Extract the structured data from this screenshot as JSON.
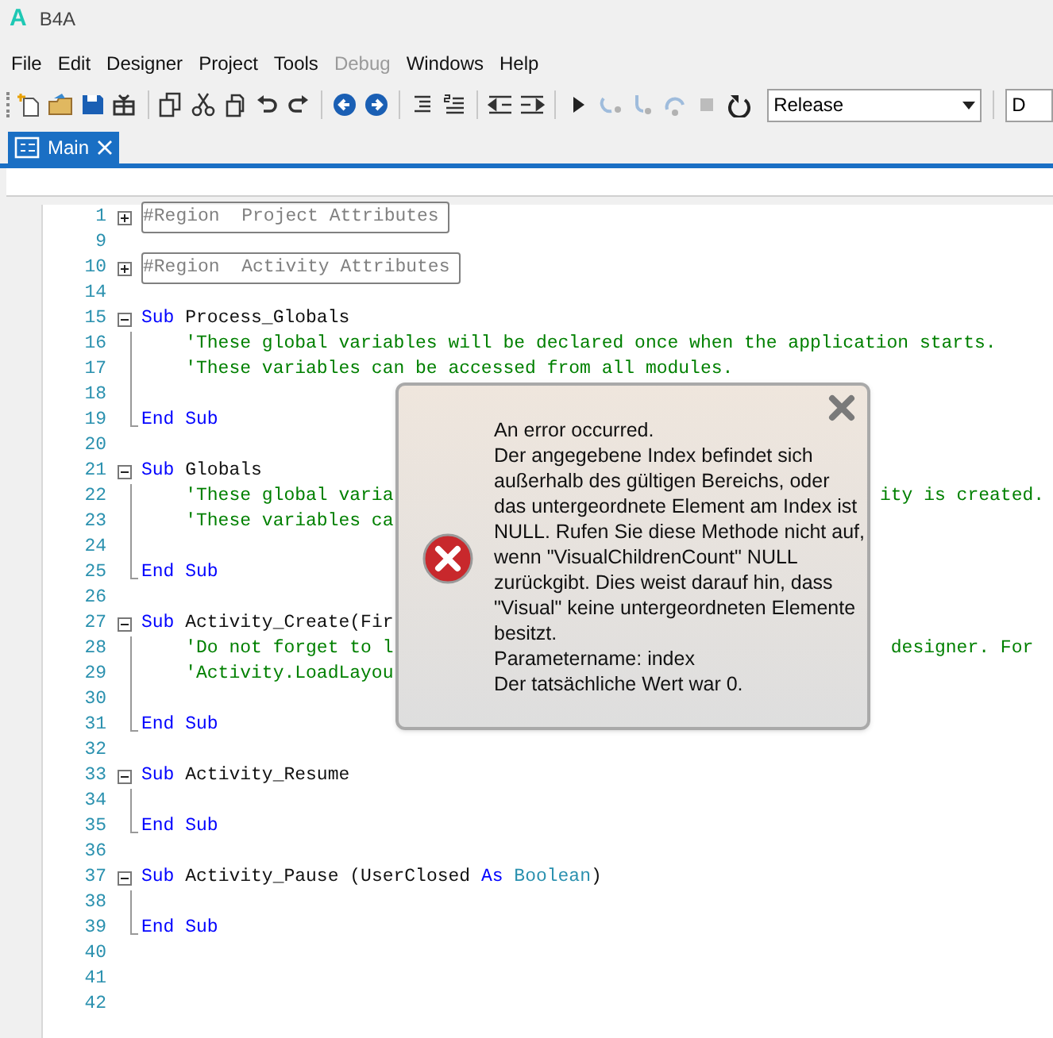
{
  "window": {
    "logo": "A",
    "title": "B4A"
  },
  "menu": [
    {
      "label": "File",
      "disabled": false
    },
    {
      "label": "Edit",
      "disabled": false
    },
    {
      "label": "Designer",
      "disabled": false
    },
    {
      "label": "Project",
      "disabled": false
    },
    {
      "label": "Tools",
      "disabled": false
    },
    {
      "label": "Debug",
      "disabled": true
    },
    {
      "label": "Windows",
      "disabled": false
    },
    {
      "label": "Help",
      "disabled": false
    }
  ],
  "toolbar": [
    {
      "kind": "new",
      "disabled": false
    },
    {
      "kind": "open",
      "disabled": false
    },
    {
      "kind": "save",
      "disabled": false
    },
    {
      "kind": "package",
      "disabled": false
    },
    {
      "kind": "sep"
    },
    {
      "kind": "copy",
      "disabled": false
    },
    {
      "kind": "cut",
      "disabled": false
    },
    {
      "kind": "paste",
      "disabled": false
    },
    {
      "kind": "undo",
      "disabled": false
    },
    {
      "kind": "redo",
      "disabled": false
    },
    {
      "kind": "sep"
    },
    {
      "kind": "back",
      "disabled": false
    },
    {
      "kind": "forward",
      "disabled": false
    },
    {
      "kind": "sep"
    },
    {
      "kind": "lines",
      "disabled": false
    },
    {
      "kind": "numbered",
      "disabled": false
    },
    {
      "kind": "sep"
    },
    {
      "kind": "outdent",
      "disabled": false
    },
    {
      "kind": "indent",
      "disabled": false
    },
    {
      "kind": "sep"
    },
    {
      "kind": "run",
      "disabled": false
    },
    {
      "kind": "step-in",
      "disabled": true
    },
    {
      "kind": "step-over",
      "disabled": true
    },
    {
      "kind": "step-out",
      "disabled": true
    },
    {
      "kind": "stop",
      "disabled": true
    },
    {
      "kind": "restart",
      "disabled": false
    }
  ],
  "build_config": {
    "value": "Release"
  },
  "second_dropdown": {
    "value": "D"
  },
  "tabs": [
    {
      "label": "Main",
      "selected": true
    }
  ],
  "code_lines": [
    {
      "number": "1",
      "kind": "plus",
      "tokens": [
        {
          "kind": "region",
          "text": "#Region  Project Attributes"
        }
      ]
    },
    {
      "number": "9",
      "kind": "none"
    },
    {
      "number": "10",
      "kind": "plus",
      "tokens": [
        {
          "kind": "region",
          "text": "#Region  Activity Attributes"
        }
      ]
    },
    {
      "number": "14",
      "kind": "none"
    },
    {
      "number": "15",
      "kind": "minus",
      "tokens": [
        {
          "kind": "keyword",
          "text": "Sub"
        },
        {
          "kind": "plain",
          "text": " Process_Globals"
        }
      ]
    },
    {
      "number": "16",
      "kind": "guide",
      "tokens": [
        {
          "kind": "comment",
          "text": "    'These global variables will be declared once when the application starts."
        }
      ]
    },
    {
      "number": "17",
      "kind": "guide",
      "tokens": [
        {
          "kind": "comment",
          "text": "    'These variables can be accessed from all modules."
        }
      ]
    },
    {
      "number": "18",
      "kind": "guide"
    },
    {
      "number": "19",
      "kind": "end",
      "tokens": [
        {
          "kind": "keyword",
          "text": "End Sub"
        }
      ]
    },
    {
      "number": "20",
      "kind": "none"
    },
    {
      "number": "21",
      "kind": "minus",
      "tokens": [
        {
          "kind": "keyword",
          "text": "Sub"
        },
        {
          "kind": "plain",
          "text": " Globals"
        }
      ]
    },
    {
      "number": "22",
      "kind": "guide",
      "tokens": [
        {
          "kind": "comment",
          "text": "    'These global varia"
        }
      ],
      "right_tokens": [
        {
          "kind": "comment",
          "text": "ity is created."
        }
      ]
    },
    {
      "number": "23",
      "kind": "guide",
      "tokens": [
        {
          "kind": "comment",
          "text": "    'These variables ca"
        }
      ]
    },
    {
      "number": "24",
      "kind": "guide"
    },
    {
      "number": "25",
      "kind": "end",
      "tokens": [
        {
          "kind": "keyword",
          "text": "End Sub"
        }
      ]
    },
    {
      "number": "26",
      "kind": "none"
    },
    {
      "number": "27",
      "kind": "minus",
      "tokens": [
        {
          "kind": "keyword",
          "text": "Sub"
        },
        {
          "kind": "plain",
          "text": " Activity_Create(Fir"
        }
      ]
    },
    {
      "number": "28",
      "kind": "guide",
      "tokens": [
        {
          "kind": "comment",
          "text": "    'Do not forget to l"
        }
      ],
      "right_tokens": [
        {
          "kind": "comment",
          "text": " designer. For"
        }
      ]
    },
    {
      "number": "29",
      "kind": "guide",
      "tokens": [
        {
          "kind": "comment",
          "text": "    'Activity.LoadLayou"
        }
      ]
    },
    {
      "number": "30",
      "kind": "guide"
    },
    {
      "number": "31",
      "kind": "end",
      "tokens": [
        {
          "kind": "keyword",
          "text": "End Sub"
        }
      ]
    },
    {
      "number": "32",
      "kind": "none"
    },
    {
      "number": "33",
      "kind": "minus",
      "tokens": [
        {
          "kind": "keyword",
          "text": "Sub"
        },
        {
          "kind": "plain",
          "text": " Activity_Resume"
        }
      ]
    },
    {
      "number": "34",
      "kind": "guide"
    },
    {
      "number": "35",
      "kind": "end",
      "tokens": [
        {
          "kind": "keyword",
          "text": "End Sub"
        }
      ]
    },
    {
      "number": "36",
      "kind": "none"
    },
    {
      "number": "37",
      "kind": "minus",
      "tokens": [
        {
          "kind": "keyword",
          "text": "Sub"
        },
        {
          "kind": "plain",
          "text": " Activity_Pause (UserClosed "
        },
        {
          "kind": "keyword",
          "text": "As "
        },
        {
          "kind": "type",
          "text": "Boolean"
        },
        {
          "kind": "plain",
          "text": ")"
        }
      ]
    },
    {
      "number": "38",
      "kind": "guide"
    },
    {
      "number": "39",
      "kind": "end",
      "tokens": [
        {
          "kind": "keyword",
          "text": "End Sub"
        }
      ]
    },
    {
      "number": "40",
      "kind": "none"
    },
    {
      "number": "41",
      "kind": "none"
    },
    {
      "number": "42",
      "kind": "none"
    }
  ],
  "error_dialog": {
    "message_lines": [
      "An error occurred.",
      "Der angegebene Index befindet sich",
      "außerhalb des gültigen Bereichs, oder",
      "das untergeordnete Element am Index ist",
      "NULL. Rufen Sie diese Methode nicht auf,",
      "wenn \"VisualChildrenCount\" NULL",
      "zurückgibt. Dies weist darauf hin, dass",
      "\"Visual\" keine untergeordneten Elemente",
      "besitzt.",
      "Parametername: index",
      "Der tatsächliche Wert war 0."
    ]
  }
}
